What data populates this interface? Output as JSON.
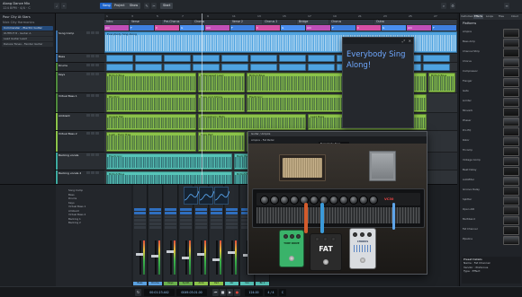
{
  "app": {
    "song_title": "Along Dance Mix",
    "song_subtitle": "124 BPM · 4/4 · C",
    "view_buttons": [
      "Song",
      "Project",
      "Show"
    ],
    "active_view": "Song",
    "button_start": "Start"
  },
  "colors": {
    "accent": "#1e63c8",
    "lyrics_text": "#6fa8ff",
    "clip_green": "#8bc34a",
    "clip_blue": "#4fa3e0",
    "clip_teal": "#56c4b8"
  },
  "inspector": {
    "song_name": "Pour City At Stars",
    "song_sub": "Nick City Harmonics",
    "presets": [
      "Commander - Electric Guitar",
      "OUTPUT 8 - Guitar A",
      "Lead Guitar Lead",
      "Deluxe Tones - Fender Guitar"
    ],
    "section_label": "Mid Pad - Fat The Grand Bundle",
    "params": [
      "Input",
      "Volume",
      "Pan",
      "Trans",
      "Tune",
      "Delay"
    ]
  },
  "tracks": {
    "headers": [
      {
        "name": "Song Comp",
        "color": "#3b6ea5"
      },
      {
        "name": "Bass",
        "color": "#3b6ea5"
      },
      {
        "name": "Drums",
        "color": "#4f8a3c"
      },
      {
        "name": "Keys",
        "color": "#4f8a3c"
      },
      {
        "name": "Virtual Bass 1",
        "color": "#4f8a3c"
      },
      {
        "name": "Ambient",
        "color": "#8bc34a"
      },
      {
        "name": "Virtual Bass 2",
        "color": "#8bc34a"
      },
      {
        "name": "Backing vocals",
        "color": "#3da9a0"
      },
      {
        "name": "Backing vocals 2",
        "color": "#3da9a0"
      }
    ]
  },
  "arrange": {
    "ruler_numbers": [
      "1",
      "3",
      "5",
      "7",
      "9",
      "11",
      "13",
      "15",
      "17",
      "19",
      "21",
      "23",
      "25",
      "27"
    ],
    "markers": [
      "Intro",
      "Verse",
      "Pre-Chorus",
      "Chorus",
      "Verse 2",
      "Chorus 2",
      "Bridge",
      "Chorus",
      "Outro"
    ],
    "arranger_title": "Everybody - Electric Lane",
    "chords": [
      "Am",
      "F",
      "C",
      "G",
      "Am",
      "F",
      "C",
      "G",
      "Am",
      "F",
      "C",
      "G",
      "Am",
      "F"
    ],
    "clip_labels": [
      "British Blue",
      "Bittersweet Lead",
      "British Blue",
      "Electronic",
      "Back Pad",
      "British Blue",
      "Everybody Sing Along",
      "Rhythm",
      "Bass and Atmos",
      "Electronic",
      "Angels Fall",
      "Atmospheric Pads",
      "Lead Bass",
      "Lush - Funk Tree",
      "Bass Pad",
      "Lush - Funk Tree"
    ]
  },
  "lyrics": {
    "text": "Everybody Sing Along!"
  },
  "browser": {
    "tabs": [
      "Instruments",
      "Effects",
      "Loops",
      "Files",
      "Cloud"
    ],
    "active_tab": "Effects",
    "heading": "Platforms",
    "items": [
      "Ampire",
      "Bass Amp",
      "Channel Strip",
      "Chorus",
      "Compressor",
      "Flanger",
      "Gate",
      "Limiter",
      "Mixverb",
      "Phaser",
      "Pro EQ",
      "Rotor",
      "Tricomp",
      "Vintage Comp",
      "Beat Delay",
      "Autofilter",
      "Groove Delay",
      "Splitter",
      "Open AIR",
      "Multiband",
      "Fat Channel",
      "Pipeline"
    ],
    "info_title": "Preset Details",
    "info_lines": [
      "Name : Fat Channel",
      "Vendor : PreSonus",
      "Type : Effect"
    ]
  },
  "mixer": {
    "list_rows": [
      "Song Comp",
      "Bass",
      "Drums",
      "Keys",
      "Virtual Bass 1",
      "Ambient",
      "Virtual Bass 2",
      "Backing 1",
      "Backing 2"
    ],
    "channels": [
      {
        "name": "Bass",
        "color": "#5aa0e0",
        "level": 0.62
      },
      {
        "name": "Drums",
        "color": "#5aa0e0",
        "level": 0.55
      },
      {
        "name": "Keys",
        "color": "#6ab04c",
        "level": 0.7
      },
      {
        "name": "Synth",
        "color": "#6ab04c",
        "level": 0.5
      },
      {
        "name": "Amb",
        "color": "#8bc34a",
        "level": 0.6
      },
      {
        "name": "Pad",
        "color": "#8bc34a",
        "level": 0.45
      },
      {
        "name": "Gtr",
        "color": "#56c4b8",
        "level": 0.66
      },
      {
        "name": "Vox",
        "color": "#56c4b8",
        "level": 0.58
      },
      {
        "name": "Bk 1",
        "color": "#56c4b8",
        "level": 0.52
      }
    ]
  },
  "plugin": {
    "title": "Guitar / Ampire",
    "subtitle": "Ampire - Fat Pedal",
    "preset_name": "Everybody Sing",
    "amp_logo": "VC30",
    "pedals": [
      {
        "name": "TUBE DRIVE",
        "color": "#3ab36a"
      },
      {
        "name": "FAT",
        "color": "#2b2b2b"
      },
      {
        "name": "CHORUS",
        "color": "#d9dce0"
      }
    ]
  },
  "transport": {
    "time": "00:01:23.442",
    "bars": "0049.03.01.00",
    "tempo": "124.00",
    "signature": "4 / 4",
    "key": "C"
  }
}
